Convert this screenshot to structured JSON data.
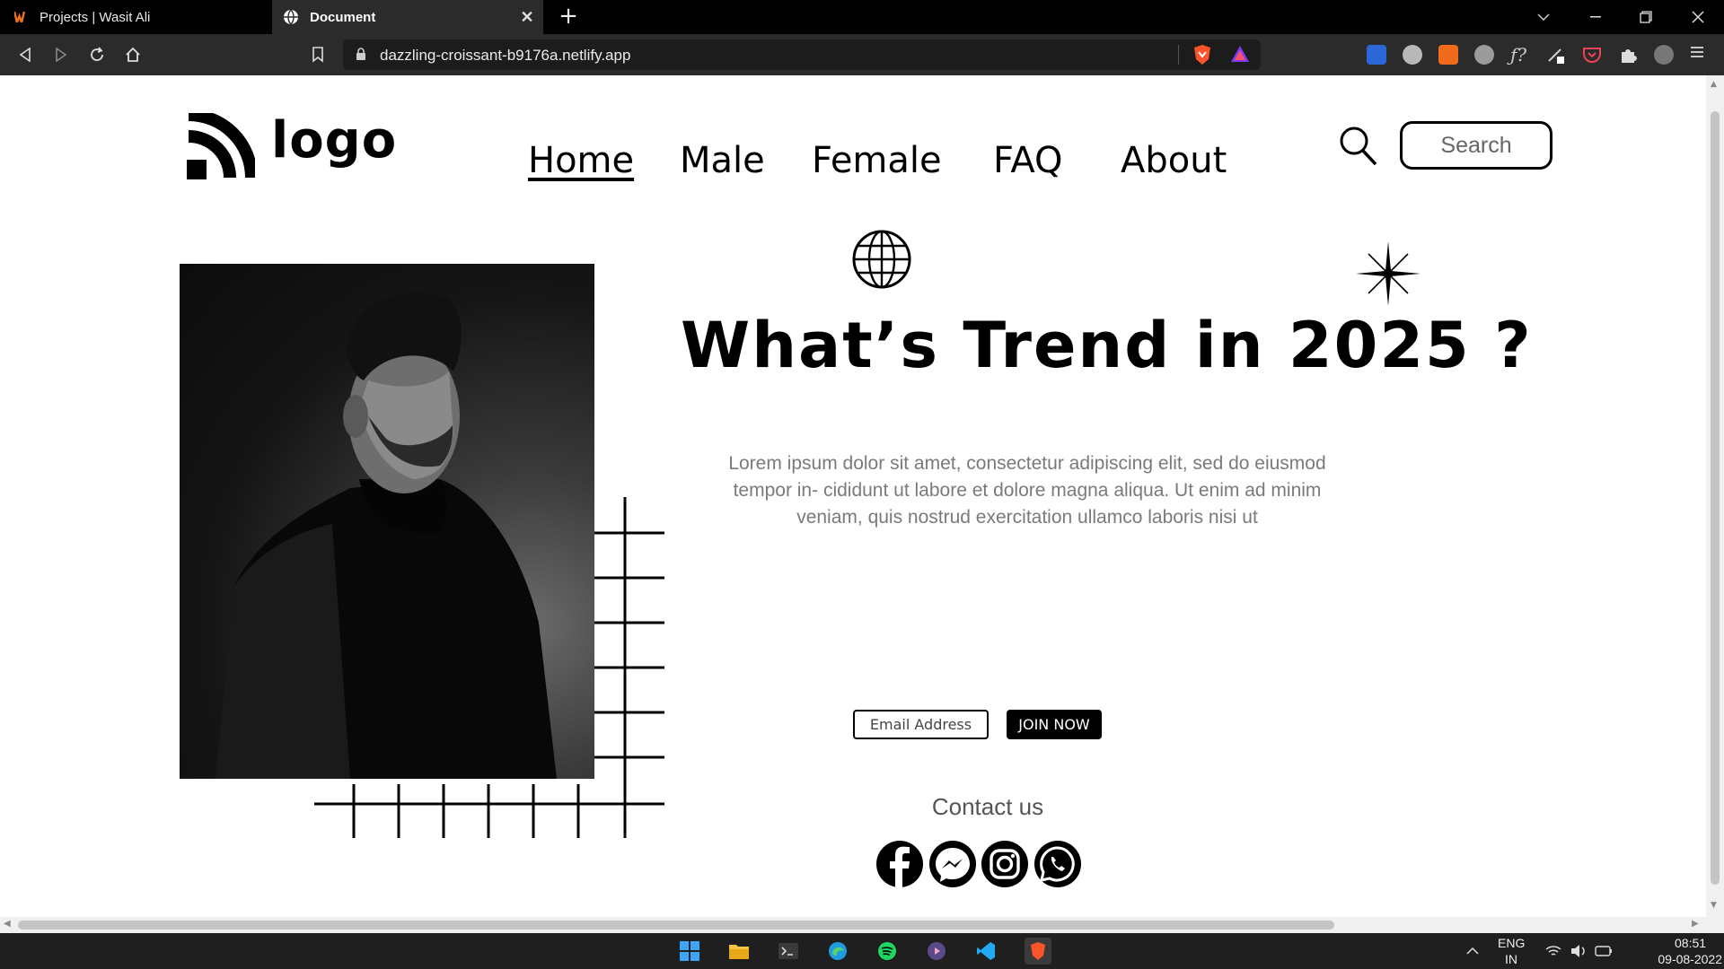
{
  "browser": {
    "tabs": [
      {
        "title": "Projects | Wasit Ali",
        "favicon": "w-logo-icon",
        "active": false
      },
      {
        "title": "Document",
        "favicon": "globe-icon",
        "active": true
      }
    ],
    "url": "dazzling-croissant-b9176a.netlify.app"
  },
  "site": {
    "logo_text": "logo",
    "nav": [
      "Home",
      "Male",
      "Female",
      "FAQ",
      "About"
    ],
    "current_nav": "Home",
    "search_placeholder": "Search",
    "headline": "What’s Trend in 2025 ?",
    "body_text": "Lorem ipsum dolor sit amet, consectetur adipiscing elit, sed do eiusmod tempor in- cididunt ut labore et dolore magna aliqua. Ut enim ad minim veniam, quis nostrud exercitation ullamco laboris nisi ut",
    "email_placeholder": "Email Address",
    "join_label": "JOIN NOW",
    "contact_heading": "Contact us",
    "socials": [
      "facebook-icon",
      "messenger-icon",
      "instagram-icon",
      "whatsapp-icon"
    ]
  },
  "taskbar": {
    "language": "ENG",
    "region": "IN",
    "time": "08:51",
    "date": "09-08-2022"
  },
  "colors": {
    "accent": "#000000",
    "muted_text": "#7a7a7a"
  }
}
